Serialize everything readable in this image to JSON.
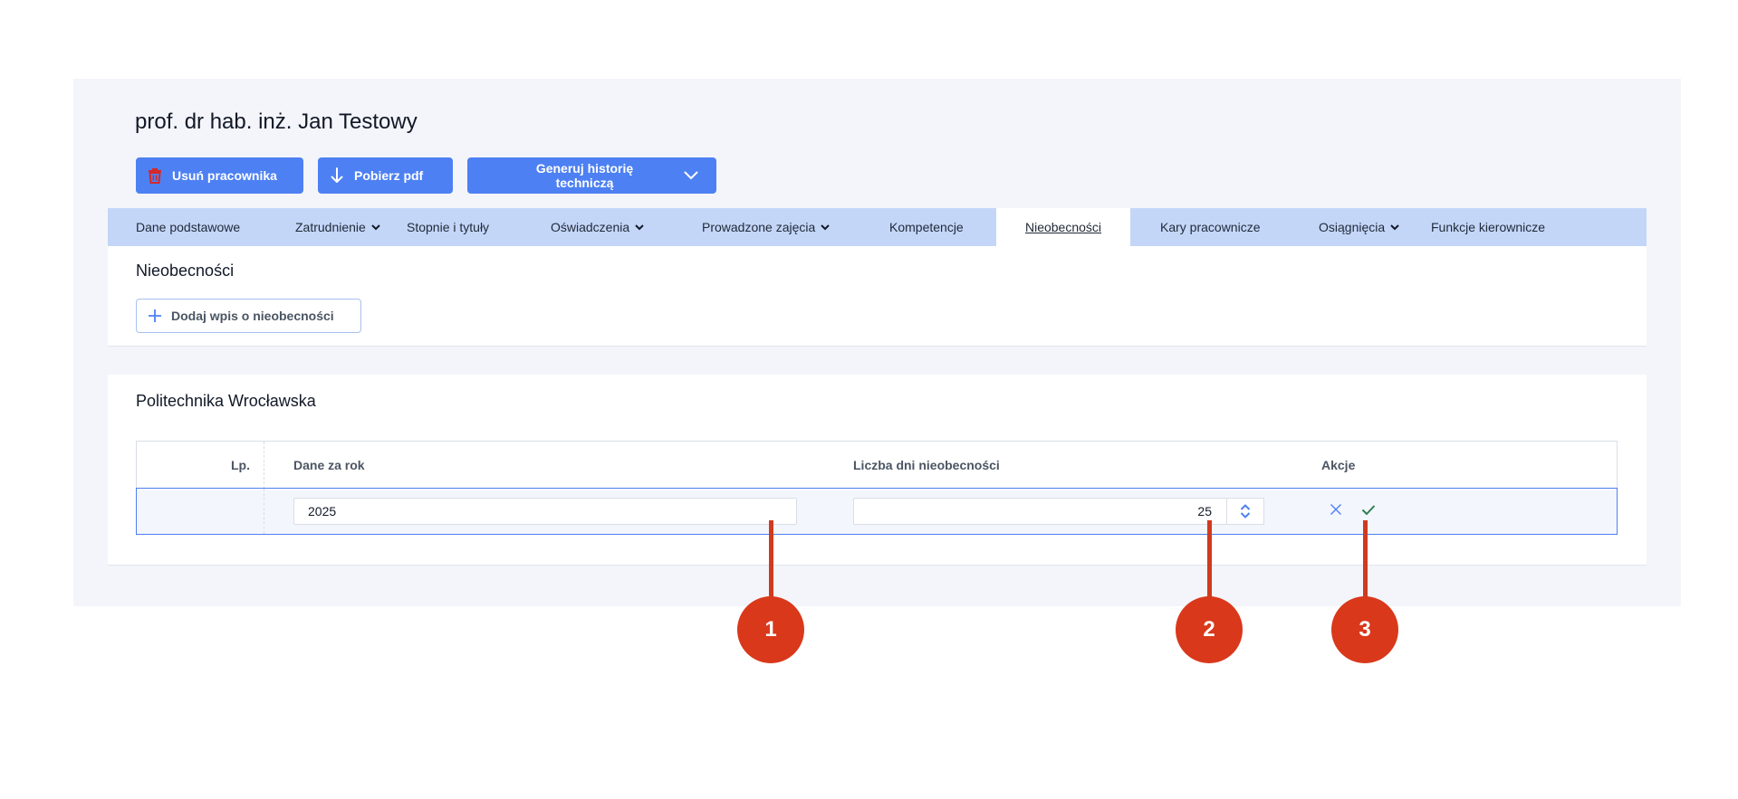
{
  "page": {
    "title": "prof. dr hab. inż. Jan Testowy"
  },
  "toolbar": {
    "delete_label": "Usuń pracownika",
    "pdf_label": "Pobierz pdf",
    "generate_label": "Generuj historię techniczą"
  },
  "tabs": [
    {
      "label": "Dane podstawowe",
      "has_dropdown": false
    },
    {
      "label": "Zatrudnienie",
      "has_dropdown": true
    },
    {
      "label": "Stopnie i tytuły",
      "has_dropdown": false
    },
    {
      "label": "Oświadczenia",
      "has_dropdown": true
    },
    {
      "label": "Prowadzone zajęcia",
      "has_dropdown": true
    },
    {
      "label": "Kompetencje",
      "has_dropdown": false
    },
    {
      "label": "Nieobecności",
      "has_dropdown": false,
      "active": true
    },
    {
      "label": "Kary pracownicze",
      "has_dropdown": false
    },
    {
      "label": "Osiągnięcia",
      "has_dropdown": true
    },
    {
      "label": "Funkcje kierownicze",
      "has_dropdown": false
    }
  ],
  "absence_section": {
    "title": "Nieobecności",
    "add_button_label": "Dodaj wpis o nieobecności"
  },
  "university_section": {
    "title": "Politechnika Wrocławska",
    "table": {
      "headers": {
        "lp": "Lp.",
        "year": "Dane za rok",
        "days": "Liczba dni nieobecności",
        "actions": "Akcje"
      },
      "edit_row": {
        "year_value": "2025",
        "days_value": "25"
      }
    }
  },
  "callouts": [
    "1",
    "2",
    "3"
  ],
  "colors": {
    "primary": "#4d80f3",
    "tab_bar": "#c4d6f8",
    "delete_icon": "#d62828",
    "confirm": "#2e7d4f",
    "callout": "#d9381b"
  }
}
